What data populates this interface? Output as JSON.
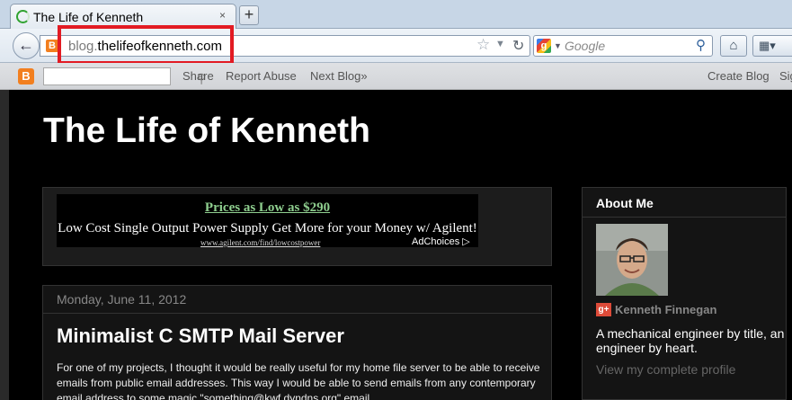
{
  "browser": {
    "tab_title": "The Life of Kenneth",
    "tab_close": "×",
    "newtab": "+",
    "url_sub": "blog.",
    "url_domain": "thelifeofkenneth.com",
    "search_placeholder": "Google",
    "highlight_color": "#e21b23"
  },
  "blogger_bar": {
    "share": "Share",
    "report_abuse": "Report Abuse",
    "next_blog": "Next Blog»",
    "create_blog": "Create Blog",
    "sign_in": "Sign In"
  },
  "blog": {
    "title": "The Life of Kenneth"
  },
  "ad": {
    "headline": "Prices as Low as $290",
    "description": "Low Cost Single Output Power Supply Get More for your Money w/ Agilent!",
    "url": "www.agilent.com/find/lowcostpower",
    "adchoices": "AdChoices ▷"
  },
  "post": {
    "date": "Monday, June 11, 2012",
    "title": "Minimalist C SMTP Mail Server",
    "body": "For one of my projects, I thought it would be really useful for my home file server to be able to receive emails from public email addresses.  This way I would be able to send emails from any contemporary email address to some magic \"something@kwf.dyndns.org\" email"
  },
  "about": {
    "heading": "About Me",
    "name": "Kenneth Finnegan",
    "description": "A mechanical engineer by title, an engineer by heart.",
    "profile_link": "View my complete profile"
  }
}
